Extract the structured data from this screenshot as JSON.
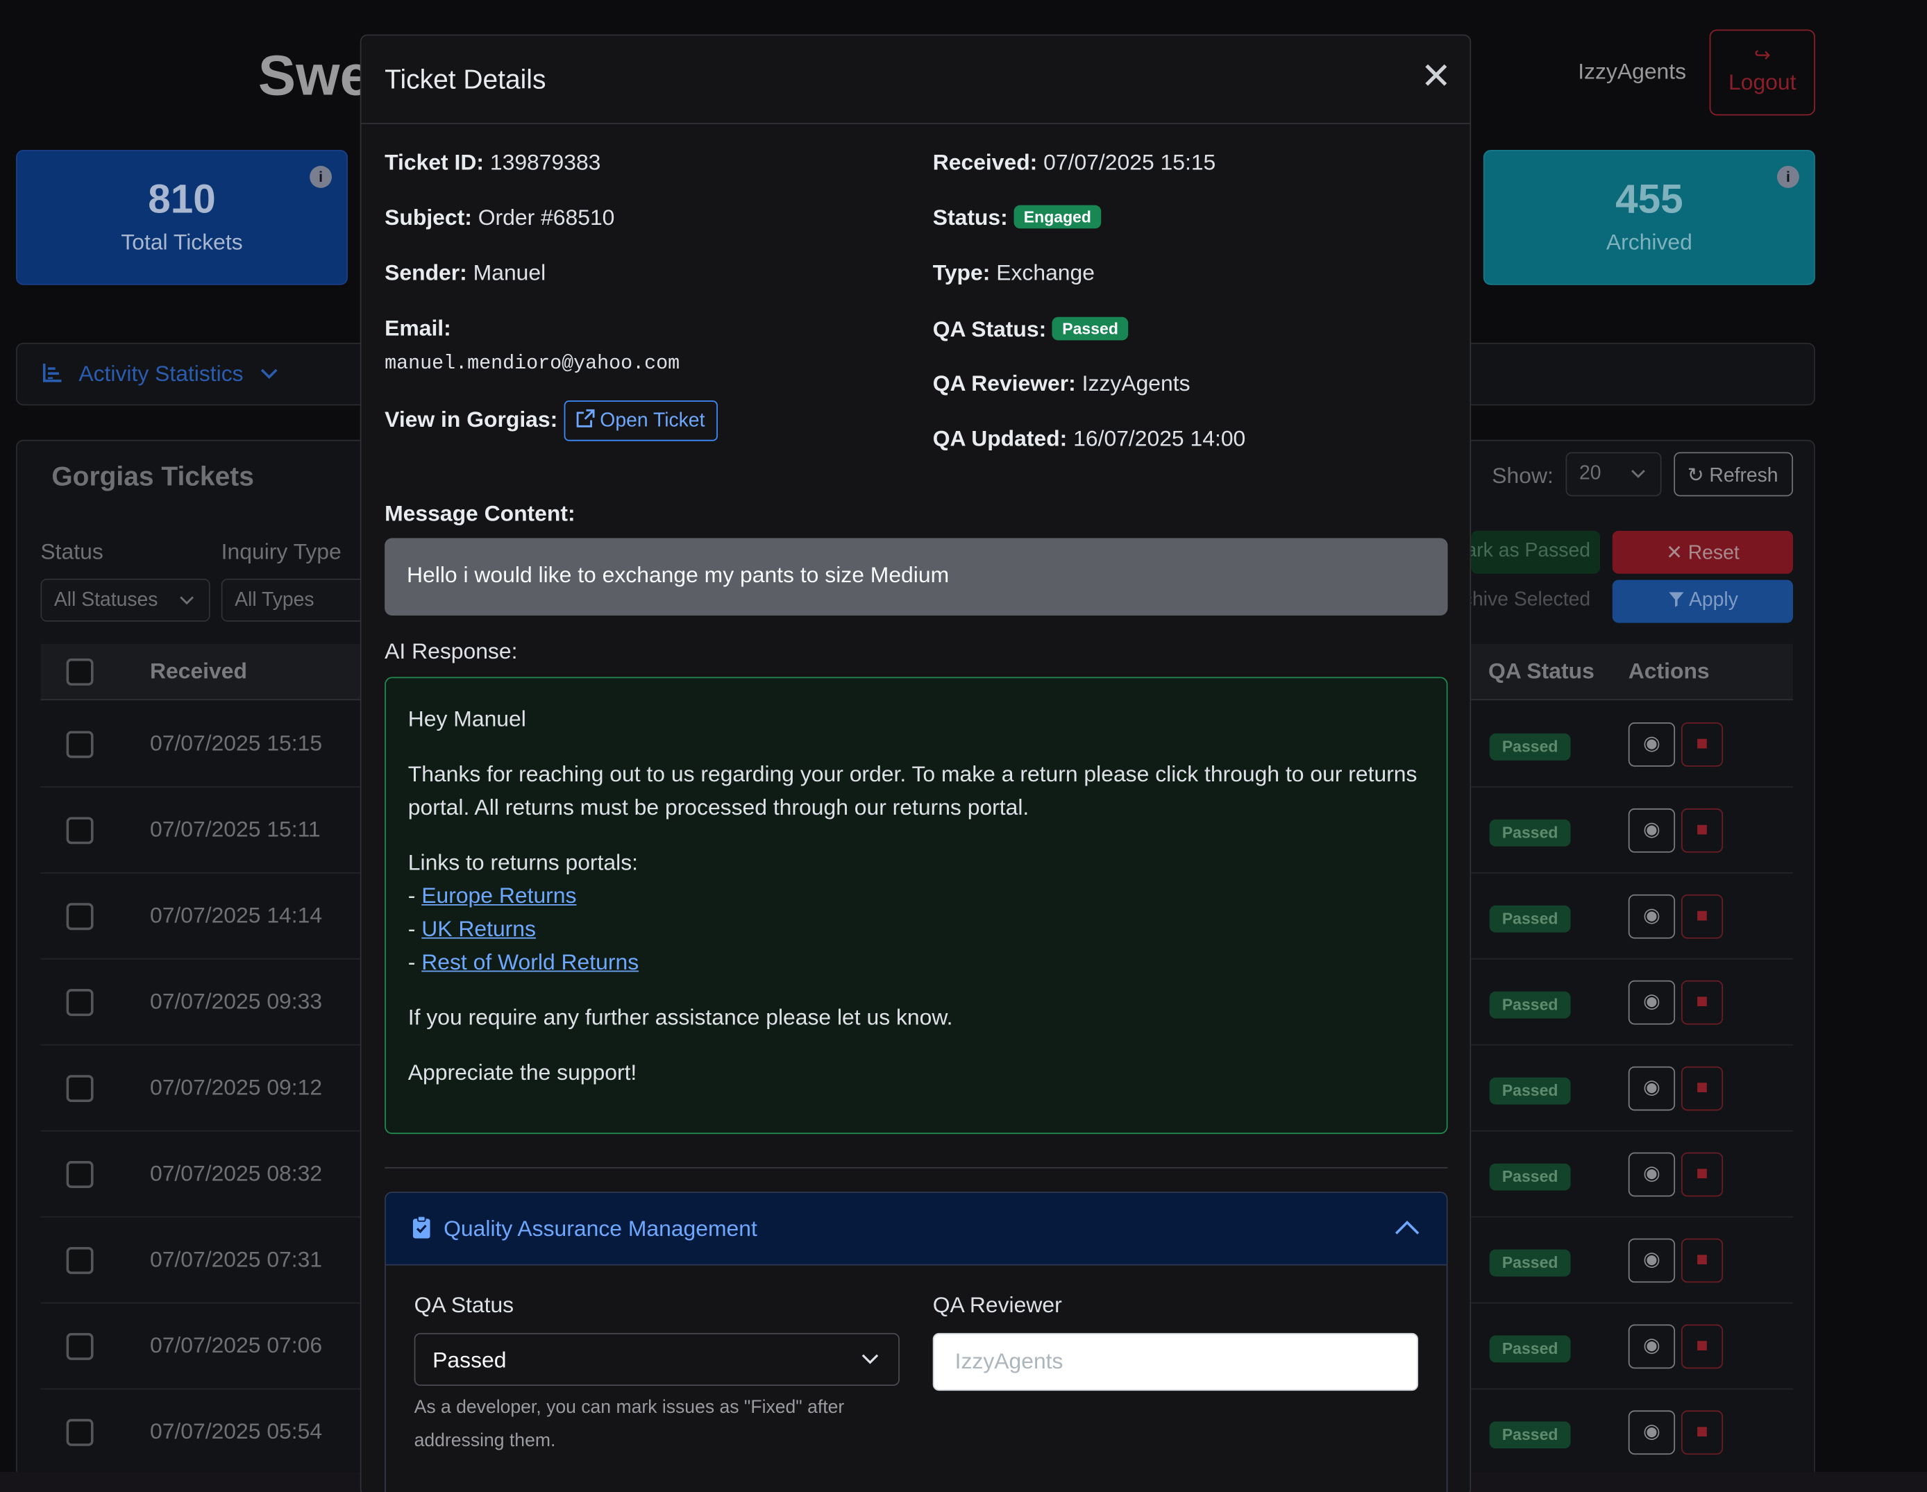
{
  "app": {
    "title": "Swe",
    "user": "IzzyAgents",
    "logout_label": "Logout"
  },
  "stats": [
    {
      "value": "810",
      "label": "Total Tickets",
      "color": "#0a3473"
    },
    {
      "value": "455",
      "label": "Archived",
      "color": "#0a6a7a"
    }
  ],
  "activity": {
    "label": "Activity Statistics"
  },
  "tickets": {
    "title": "Gorgias Tickets",
    "show_label": "Show:",
    "show_value": "20",
    "refresh_label": "Refresh",
    "filters": {
      "status_label": "Status",
      "status_value": "All Statuses",
      "type_label": "Inquiry Type",
      "type_value": "All Types"
    },
    "mark_passed_label": "Mark as Passed",
    "archive_selected_label": "Archive Selected",
    "reset_label": "Reset",
    "apply_label": "Apply",
    "columns": {
      "received": "Received",
      "qa_status": "QA Status",
      "actions": "Actions"
    },
    "rows": [
      {
        "received": "07/07/2025 15:15",
        "qa_status": "Passed"
      },
      {
        "received": "07/07/2025 15:11",
        "qa_status": "Passed"
      },
      {
        "received": "07/07/2025 14:14",
        "qa_status": "Passed"
      },
      {
        "received": "07/07/2025 09:33",
        "qa_status": "Passed"
      },
      {
        "received": "07/07/2025 09:12",
        "qa_status": "Passed"
      },
      {
        "received": "07/07/2025 08:32",
        "qa_status": "Passed"
      },
      {
        "received": "07/07/2025 07:31",
        "qa_status": "Passed"
      },
      {
        "received": "07/07/2025 07:06",
        "qa_status": "Passed"
      },
      {
        "received": "07/07/2025 05:54",
        "qa_status": "Passed"
      }
    ]
  },
  "modal": {
    "title": "Ticket Details",
    "ticket_id_label": "Ticket ID:",
    "ticket_id": "139879383",
    "subject_label": "Subject:",
    "subject": "Order #68510",
    "sender_label": "Sender:",
    "sender": "Manuel",
    "email_label": "Email:",
    "email": "manuel.mendioro@yahoo.com",
    "gorgias_label": "View in Gorgias:",
    "open_ticket_label": "Open Ticket",
    "received_label": "Received:",
    "received": "07/07/2025 15:15",
    "status_label": "Status:",
    "status": "Engaged",
    "type_label": "Type:",
    "type": "Exchange",
    "qa_status_label": "QA Status:",
    "qa_status": "Passed",
    "qa_reviewer_label": "QA Reviewer:",
    "qa_reviewer": "IzzyAgents",
    "qa_updated_label": "QA Updated:",
    "qa_updated": "16/07/2025 14:00",
    "message_label": "Message Content:",
    "message": "Hello i would like to exchange my pants to size Medium",
    "ai_label": "AI Response:",
    "ai": {
      "greeting": "Hey Manuel",
      "para1": "Thanks for reaching out to us regarding your order. To make a return please click through to our returns portal. All returns must be processed through our returns portal.",
      "links_intro": "Links to returns portals:",
      "dash": "- ",
      "link1": "Europe Returns",
      "link2": "UK Returns",
      "link3": "Rest of World Returns",
      "para2": "If you require any further assistance please let us know.",
      "closing": "Appreciate the support!"
    },
    "qa_panel": {
      "title": "Quality Assurance Management",
      "status_label": "QA Status",
      "status_value": "Passed",
      "reviewer_label": "QA Reviewer",
      "reviewer_placeholder": "IzzyAgents",
      "help": "As a developer, you can mark issues as \"Fixed\" after addressing them."
    }
  }
}
